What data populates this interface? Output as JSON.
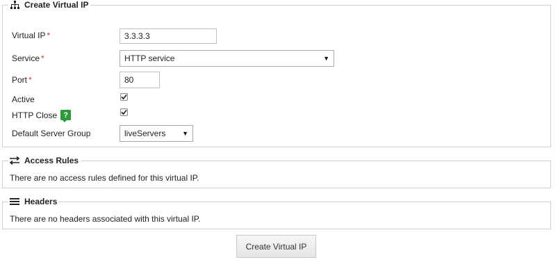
{
  "create_section": {
    "title": "Create Virtual IP",
    "fields": {
      "virtual_ip": {
        "label": "Virtual IP",
        "required_mark": "*",
        "value": "3.3.3.3"
      },
      "service": {
        "label": "Service",
        "required_mark": "*",
        "selected": "HTTP service"
      },
      "port": {
        "label": "Port",
        "required_mark": "*",
        "value": "80"
      },
      "active": {
        "label": "Active",
        "checked": true
      },
      "http_close": {
        "label": "HTTP Close",
        "checked": true,
        "help_glyph": "?"
      },
      "default_server_group": {
        "label": "Default Server Group",
        "selected": "liveServers"
      }
    }
  },
  "access_rules": {
    "title": "Access Rules",
    "empty_text": "There are no access rules defined for this virtual IP."
  },
  "headers": {
    "title": "Headers",
    "empty_text": "There are no headers associated with this virtual IP."
  },
  "submit": {
    "label": "Create Virtual IP"
  },
  "icons": {
    "sitemap": "sitemap-icon",
    "arrows": "transfer-arrows-icon",
    "list": "list-icon",
    "help": "help-icon",
    "check": "check-icon",
    "dropdown": "dropdown-arrow-icon"
  },
  "colors": {
    "required": "#d9302c",
    "help_bg": "#2b9b3a",
    "border": "#cfcfcf"
  }
}
